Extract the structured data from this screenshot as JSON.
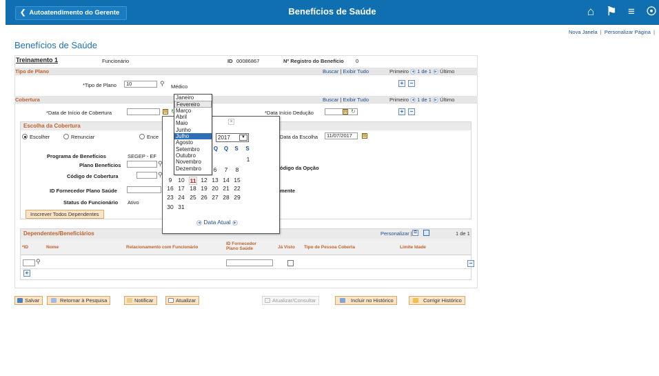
{
  "header": {
    "back_label": "Autoatendimento do Gerente",
    "title": "Benefícios de Saúde",
    "icons": [
      "home-icon",
      "flag-icon",
      "menu-icon",
      "compass-icon"
    ]
  },
  "toplinks": {
    "new_window": "Nova Janela",
    "sep": "|",
    "personalize": "Personalizar Página",
    "sep2": "|"
  },
  "page_title": "Benefícios de Saúde",
  "info": {
    "training": "Treinamento 1",
    "role": "Funcionário",
    "id_label": "ID",
    "id_value": "00086867",
    "reg_label": "Nº Registro do Benefício",
    "reg_value": "0"
  },
  "plan_type": {
    "section": "Tipo de Plano",
    "search": "Buscar",
    "sep": "|",
    "show_all": "Exibir Tudo",
    "first": "Primeiro",
    "count": "1 de 1",
    "last": "Último",
    "field_label": "*Tipo de Plano",
    "field_value": "10",
    "field_desc": "Médico"
  },
  "coverage": {
    "section": "Cobertura",
    "search": "Buscar",
    "sep": "|",
    "show_all": "Exibir Tudo",
    "first": "Primeiro",
    "count": "1 de 1",
    "last": "Último",
    "start_label": "*Data de Início de Cobertura",
    "start_value": "",
    "deduction_label": "*Data Início Dedução",
    "deduction_value": ""
  },
  "choice": {
    "heading": "Escolha da Cobertura",
    "radio_choose": "Escolher",
    "radio_decline": "Renunciar",
    "radio_end": "Ence",
    "choice_date_label": "Data da Escolha",
    "choice_date_value": "11/07/2017",
    "program_label": "Programa de Benefícios",
    "program_value": "SEGEP - EF",
    "plan_label": "Plano Benefícios",
    "coverage_code_label": "Código de Cobertura",
    "provider_label": "ID Fornecedor Plano Saúde",
    "status_label": "Status do Funcionário",
    "status_value": "Ativo",
    "option_code_label": "ódigo da Opção",
    "mente_label": "mente",
    "enroll_all_button": "Inscrever Todos Dependentes"
  },
  "dependents": {
    "heading": "Dependentes/Beneficiários",
    "personalize": "Personalizar",
    "sep": "|",
    "count": "1 de 1",
    "columns": [
      "*ID",
      "Nome",
      "Relacionamento com Funcionário",
      "ID Fornecedor Plano Saúde",
      "Já Visto",
      "Tipo de Pessoa Coberta",
      "Limite Idade"
    ]
  },
  "footer": {
    "save": "Salvar",
    "return_search": "Retornar à Pesquisa",
    "notify": "Notificar",
    "refresh": "Atualizar",
    "update_view": "Atualizar/Consultar",
    "include_history": "Incluir no Histórico",
    "correct_history": "Corrigir Histórico"
  },
  "calendar": {
    "close": "×",
    "year": "2017",
    "weekdays": [
      "Q",
      "Q",
      "S",
      "S"
    ],
    "rows": [
      [
        "",
        "",
        "",
        "",
        "1"
      ],
      [
        "5",
        "6",
        "7",
        "8"
      ],
      [
        "9",
        "10",
        "11",
        "12",
        "13",
        "14",
        "15"
      ],
      [
        "16",
        "17",
        "18",
        "19",
        "20",
        "21",
        "22"
      ],
      [
        "23",
        "24",
        "25",
        "26",
        "27",
        "28",
        "29"
      ],
      [
        "30",
        "31"
      ]
    ],
    "selected_day": "11",
    "today_link": "Data Atual",
    "months": [
      "Janeiro",
      "Fevereiro",
      "Março",
      "Abril",
      "Maio",
      "Junho",
      "Julho",
      "Agosto",
      "Setembro",
      "Outubro",
      "Novembro",
      "Dezembro"
    ],
    "selected_month": "Julho",
    "hover_month": "Fevereiro"
  }
}
